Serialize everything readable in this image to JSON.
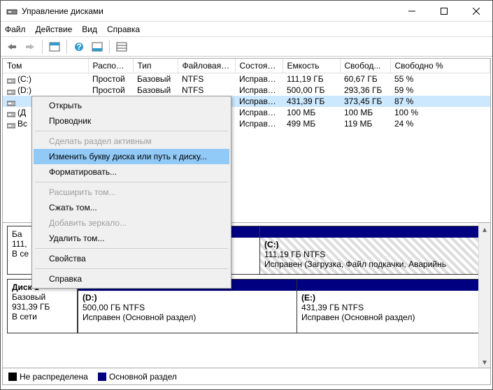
{
  "window": {
    "title": "Управление дисками"
  },
  "menu": {
    "file": "Файл",
    "action": "Действие",
    "view": "Вид",
    "help": "Справка"
  },
  "columns": {
    "volume": "Том",
    "layout": "Располо...",
    "type": "Тип",
    "fs": "Файловая с...",
    "status": "Состояние",
    "capacity": "Емкость",
    "free": "Свобод...",
    "free_pct": "Свободно %"
  },
  "rows": [
    {
      "vol": "(C:)",
      "layout": "Простой",
      "type": "Базовый",
      "fs": "NTFS",
      "status": "Исправен...",
      "cap": "111,19 ГБ",
      "free": "60,67 ГБ",
      "pct": "55 %",
      "sel": false
    },
    {
      "vol": "(D:)",
      "layout": "Простой",
      "type": "Базовый",
      "fs": "NTFS",
      "status": "Исправен...",
      "cap": "500,00 ГБ",
      "free": "293,36 ГБ",
      "pct": "59 %",
      "sel": false
    },
    {
      "vol": "",
      "layout": "",
      "type": "",
      "fs": "",
      "status": "Исправен...",
      "cap": "431,39 ГБ",
      "free": "373,45 ГБ",
      "pct": "87 %",
      "sel": true
    },
    {
      "vol": "(Д",
      "layout": "",
      "type": "",
      "fs": "",
      "status": "Исправен...",
      "cap": "100 МБ",
      "free": "100 МБ",
      "pct": "100 %",
      "sel": false
    },
    {
      "vol": "Вс",
      "layout": "",
      "type": "",
      "fs": "",
      "status": "Исправен...",
      "cap": "499 МБ",
      "free": "119 МБ",
      "pct": "24 %",
      "sel": false
    }
  ],
  "disks": {
    "d0": {
      "label_prefix": "Ба",
      "cap": "111,",
      "status": "В се",
      "p0name": "(C:)",
      "p0info": "111,19 ГБ NTFS",
      "p0status": "Исправен (Загрузка, Файл подкачки, Аварийнь"
    },
    "d1": {
      "name": "Диск 1",
      "type": "Базовый",
      "cap": "931,39 ГБ",
      "status": "В сети",
      "p0name": "(D:)",
      "p0info": "500,00 ГБ NTFS",
      "p0status": "Исправен (Основной раздел)",
      "p1name": "(E:)",
      "p1info": "431,39 ГБ NTFS",
      "p1status": "Исправен (Основной раздел)"
    }
  },
  "legend": {
    "unalloc": "Не распределена",
    "primary": "Основной раздел"
  },
  "ctx": {
    "open": "Открыть",
    "explorer": "Проводник",
    "active": "Сделать раздел активным",
    "change": "Изменить букву диска или путь к диску...",
    "format": "Форматировать...",
    "extend": "Расширить том...",
    "shrink": "Сжать том...",
    "mirror": "Добавить зеркало...",
    "delete": "Удалить том...",
    "props": "Свойства",
    "help": "Справка"
  }
}
